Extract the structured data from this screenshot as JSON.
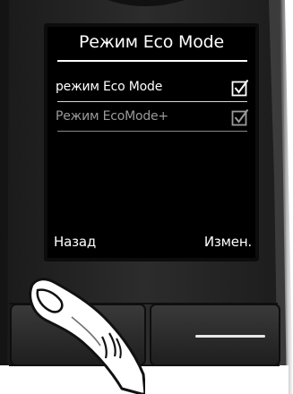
{
  "screen": {
    "title": "Режим Eco Mode",
    "items": [
      {
        "label": "режим Eco Mode",
        "checked": true,
        "enabled": true
      },
      {
        "label": "Режим EcoMode+",
        "checked": true,
        "enabled": false
      }
    ],
    "softkeys": {
      "left": "Назад",
      "right": "Измен."
    }
  },
  "icons": {
    "checkbox": "checkbox-checked-icon",
    "finger": "pointing-finger-icon",
    "end_key": "end-call-key-icon"
  },
  "colors": {
    "screen_bg": "#000000",
    "screen_text": "#ffffff",
    "disabled_text": "#9a9a9a",
    "phone_body": "#2a2a2a"
  }
}
